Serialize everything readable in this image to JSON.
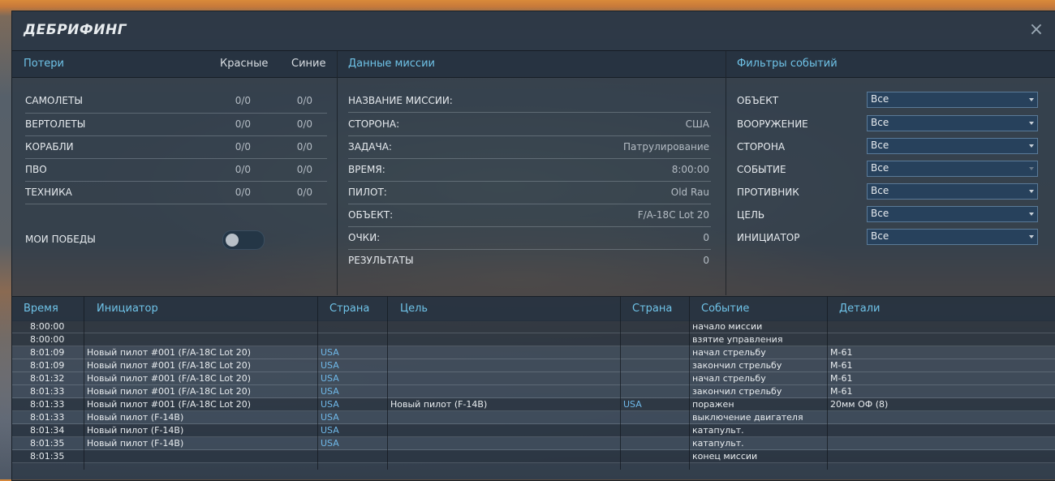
{
  "window": {
    "title": "ДЕБРИФИНГ",
    "close_icon": "×"
  },
  "losses": {
    "header": "Потери",
    "col_red": "Красные",
    "col_blue": "Синие",
    "rows": [
      {
        "label": "САМОЛЕТЫ",
        "red": "0/0",
        "blue": "0/0"
      },
      {
        "label": "ВЕРТОЛЕТЫ",
        "red": "0/0",
        "blue": "0/0"
      },
      {
        "label": "КОРАБЛИ",
        "red": "0/0",
        "blue": "0/0"
      },
      {
        "label": "ПВО",
        "red": "0/0",
        "blue": "0/0"
      },
      {
        "label": "ТЕХНИКА",
        "red": "0/0",
        "blue": "0/0"
      }
    ],
    "my_wins_label": "МОИ ПОБЕДЫ",
    "my_wins_on": false
  },
  "mission": {
    "header": "Данные миссии",
    "rows": [
      {
        "label": "НАЗВАНИЕ МИССИИ:",
        "value": ""
      },
      {
        "label": "СТОРОНА:",
        "value": "США"
      },
      {
        "label": "ЗАДАЧА:",
        "value": "Патрулирование"
      },
      {
        "label": "ВРЕМЯ:",
        "value": "8:00:00"
      },
      {
        "label": "ПИЛОТ:",
        "value": "Old Rau"
      },
      {
        "label": "ОБЪЕКТ:",
        "value": "F/A-18C Lot 20"
      },
      {
        "label": "ОЧКИ:",
        "value": "0"
      },
      {
        "label": "РЕЗУЛЬТАТЫ",
        "value": "0"
      }
    ]
  },
  "filters": {
    "header": "Фильтры событий",
    "rows": [
      {
        "label": "ОБЪЕКТ",
        "value": "Все",
        "enabled": true
      },
      {
        "label": "ВООРУЖЕНИЕ",
        "value": "Все",
        "enabled": true
      },
      {
        "label": "СТОРОНА",
        "value": "Все",
        "enabled": true
      },
      {
        "label": "СОБЫТИЕ",
        "value": "Все",
        "enabled": false
      },
      {
        "label": "ПРОТИВНИК",
        "value": "Все",
        "enabled": true
      },
      {
        "label": "ЦЕЛЬ",
        "value": "Все",
        "enabled": true
      },
      {
        "label": "ИНИЦИАТОР",
        "value": "Все",
        "enabled": true
      }
    ]
  },
  "events": {
    "columns": [
      "Время",
      "Инициатор",
      "Страна",
      "Цель",
      "Страна",
      "Событие",
      "Детали"
    ],
    "rows": [
      [
        "8:00:00",
        "",
        "",
        "",
        "",
        "начало миссии",
        ""
      ],
      [
        "8:00:00",
        "",
        "",
        "",
        "",
        "взятие управления",
        ""
      ],
      [
        "8:01:09",
        "Новый пилот #001 (F/A-18C Lot 20)",
        "USA",
        "",
        "",
        "начал стрельбу",
        "M-61"
      ],
      [
        "8:01:09",
        "Новый пилот #001 (F/A-18C Lot 20)",
        "USA",
        "",
        "",
        "закончил стрельбу",
        "M-61"
      ],
      [
        "8:01:32",
        "Новый пилот #001 (F/A-18C Lot 20)",
        "USA",
        "",
        "",
        "начал стрельбу",
        "M-61"
      ],
      [
        "8:01:33",
        "Новый пилот #001 (F/A-18C Lot 20)",
        "USA",
        "",
        "",
        "закончил стрельбу",
        "M-61"
      ],
      [
        "8:01:33",
        "Новый пилот #001 (F/A-18C Lot 20)",
        "USA",
        "Новый пилот (F-14B)",
        "USA",
        "поражен",
        "20мм ОФ (8)"
      ],
      [
        "8:01:33",
        "Новый пилот (F-14B)",
        "USA",
        "",
        "",
        "выключение двигателя",
        ""
      ],
      [
        "8:01:34",
        "Новый пилот (F-14B)",
        "USA",
        "",
        "",
        "катапульт.",
        ""
      ],
      [
        "8:01:35",
        "Новый пилот (F-14B)",
        "USA",
        "",
        "",
        "катапульт.",
        ""
      ],
      [
        "8:01:35",
        "",
        "",
        "",
        "",
        "конец миссии",
        ""
      ]
    ]
  },
  "colors": {
    "accent": "#6fc3e8",
    "link": "#6fb8e8"
  }
}
